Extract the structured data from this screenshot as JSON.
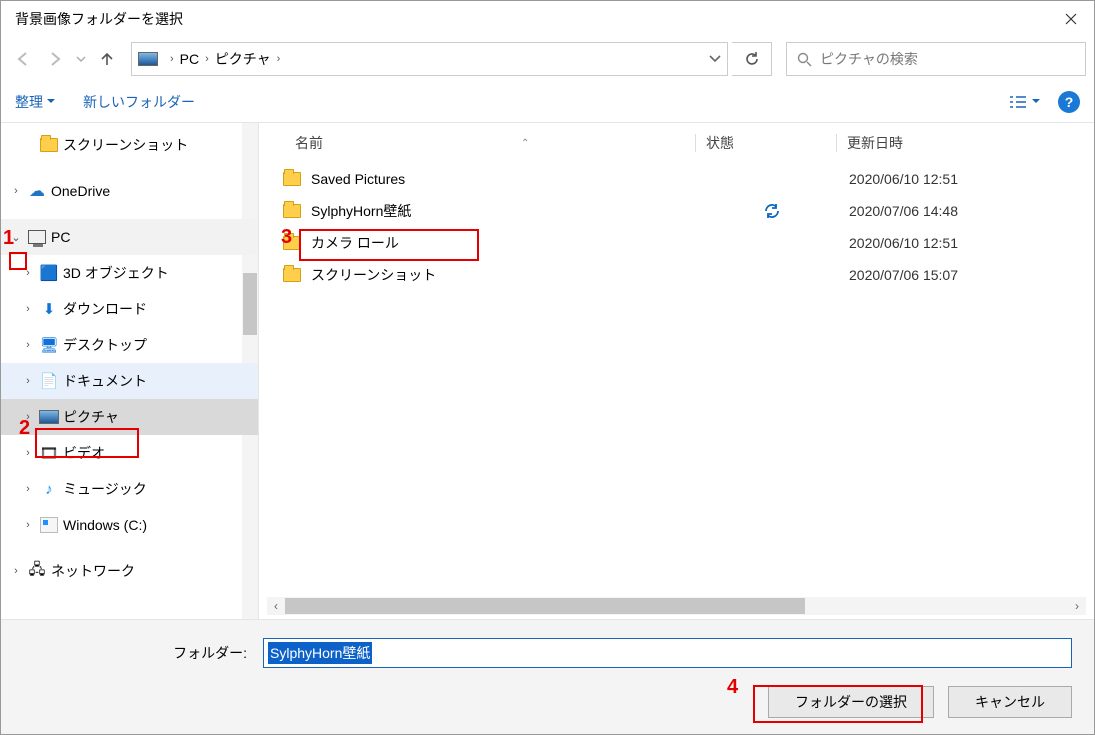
{
  "title": "背景画像フォルダーを選択",
  "breadcrumb": {
    "root": "PC",
    "folder": "ピクチャ"
  },
  "search": {
    "placeholder": "ピクチャの検索"
  },
  "toolbar": {
    "organize": "整理",
    "newFolder": "新しいフォルダー"
  },
  "tree": {
    "screenshotFolder": "スクリーンショット",
    "onedrive": "OneDrive",
    "pc": "PC",
    "objects3d": "3D オブジェクト",
    "downloads": "ダウンロード",
    "desktop": "デスクトップ",
    "documents": "ドキュメント",
    "pictures": "ピクチャ",
    "videos": "ビデオ",
    "music": "ミュージック",
    "cdrive": "Windows (C:)",
    "network": "ネットワーク"
  },
  "columns": {
    "name": "名前",
    "status": "状態",
    "date": "更新日時"
  },
  "rows": [
    {
      "name": "Saved Pictures",
      "status": "",
      "date": "2020/06/10 12:51"
    },
    {
      "name": "SylphyHorn壁紙",
      "status": "sync",
      "date": "2020/07/06 14:48"
    },
    {
      "name": "カメラ ロール",
      "status": "",
      "date": "2020/06/10 12:51"
    },
    {
      "name": "スクリーンショット",
      "status": "",
      "date": "2020/07/06 15:07"
    }
  ],
  "bottom": {
    "label": "フォルダー:",
    "value": "SylphyHorn壁紙",
    "select": "フォルダーの選択",
    "cancel": "キャンセル"
  },
  "annotations": {
    "n1": "1",
    "n2": "2",
    "n3": "3",
    "n4": "4"
  }
}
